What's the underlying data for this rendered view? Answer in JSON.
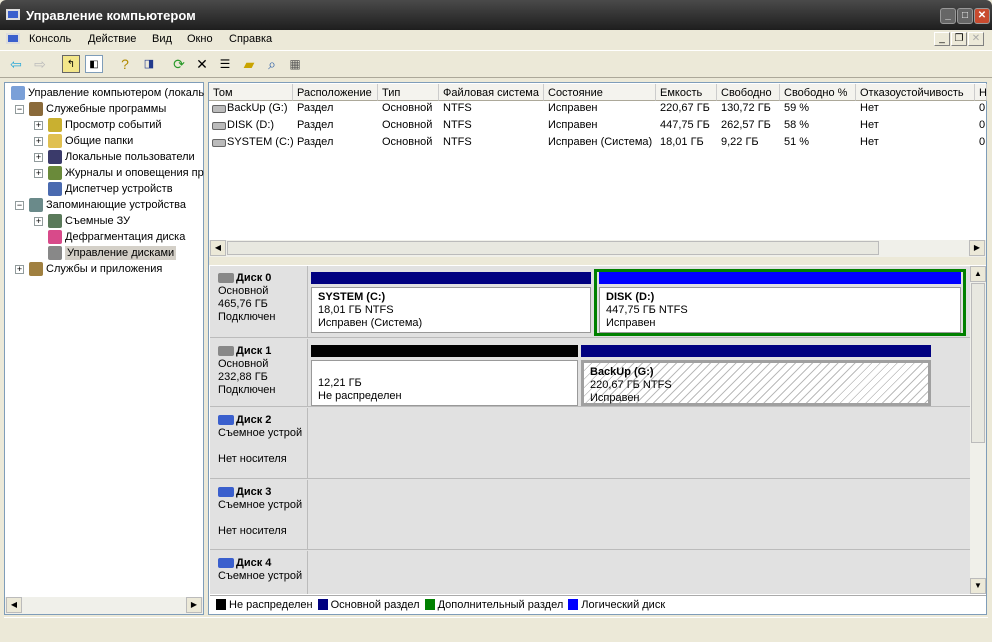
{
  "window": {
    "title": "Управление компьютером"
  },
  "menu": [
    "Консоль",
    "Действие",
    "Вид",
    "Окно",
    "Справка"
  ],
  "toolbar": [
    "back-icon",
    "forward-icon",
    "up-icon",
    "show-hide-tree-icon",
    "help-icon",
    "action-pane-icon",
    "refresh-icon",
    "delete-icon",
    "properties-icon",
    "open-icon",
    "search-icon",
    "settings-icon"
  ],
  "tree": [
    {
      "label": "Управление компьютером (локаль",
      "level": 0
    },
    {
      "label": "Служебные программы",
      "level": 1,
      "expander": "−"
    },
    {
      "label": "Просмотр событий",
      "level": 2,
      "expander": "+"
    },
    {
      "label": "Общие папки",
      "level": 2,
      "expander": "+"
    },
    {
      "label": "Локальные пользователи",
      "level": 2,
      "expander": "+"
    },
    {
      "label": "Журналы и оповещения пр",
      "level": 2,
      "expander": "+"
    },
    {
      "label": "Диспетчер устройств",
      "level": 2
    },
    {
      "label": "Запоминающие устройства",
      "level": 1,
      "expander": "−"
    },
    {
      "label": "Съемные ЗУ",
      "level": 2,
      "expander": "+"
    },
    {
      "label": "Дефрагментация диска",
      "level": 2
    },
    {
      "label": "Управление дисками",
      "level": 2,
      "selected": true
    },
    {
      "label": "Службы и приложения",
      "level": 1,
      "expander": "+"
    }
  ],
  "volumes": {
    "columns": [
      "Том",
      "Расположение",
      "Тип",
      "Файловая система",
      "Состояние",
      "Емкость",
      "Свободно",
      "Свободно %",
      "Отказоустойчивость",
      "Н"
    ],
    "rows": [
      [
        "BackUp (G:)",
        "Раздел",
        "Основной",
        "NTFS",
        "Исправен",
        "220,67 ГБ",
        "130,72 ГБ",
        "59 %",
        "Нет",
        "0"
      ],
      [
        "DISK (D:)",
        "Раздел",
        "Основной",
        "NTFS",
        "Исправен",
        "447,75 ГБ",
        "262,57 ГБ",
        "58 %",
        "Нет",
        "0"
      ],
      [
        "SYSTEM (C:)",
        "Раздел",
        "Основной",
        "NTFS",
        "Исправен (Система)",
        "18,01 ГБ",
        "9,22 ГБ",
        "51 %",
        "Нет",
        "0"
      ]
    ]
  },
  "disks": [
    {
      "name": "Диск 0",
      "type": "Основной",
      "size": "465,76 ГБ",
      "status": "Подключен",
      "partitions": [
        {
          "title": "SYSTEM  (C:)",
          "size": "18,01 ГБ NTFS",
          "state": "Исправен (Система)",
          "kind": "primary"
        },
        {
          "title": "DISK  (D:)",
          "size": "447,75 ГБ NTFS",
          "state": "Исправен",
          "kind": "primary",
          "selected": true
        }
      ]
    },
    {
      "name": "Диск 1",
      "type": "Основной",
      "size": "232,88 ГБ",
      "status": "Подключен",
      "partitions": [
        {
          "title": "",
          "size": "12,21 ГБ",
          "state": "Не распределен",
          "kind": "unallocated"
        },
        {
          "title": "BackUp  (G:)",
          "size": "220,67 ГБ NTFS",
          "state": "Исправен",
          "kind": "primary",
          "hatched": true
        }
      ]
    },
    {
      "name": "Диск 2",
      "type": "Съемное устрой",
      "status": "Нет носителя"
    },
    {
      "name": "Диск 3",
      "type": "Съемное устрой",
      "status": "Нет носителя"
    },
    {
      "name": "Диск 4",
      "type": "Съемное устрой"
    }
  ],
  "legend": [
    {
      "label": "Не распределен",
      "color": "#000000"
    },
    {
      "label": "Основной раздел",
      "color": "#000080"
    },
    {
      "label": "Дополнительный раздел",
      "color": "#008000"
    },
    {
      "label": "Логический диск",
      "color": "#0000ff"
    }
  ]
}
